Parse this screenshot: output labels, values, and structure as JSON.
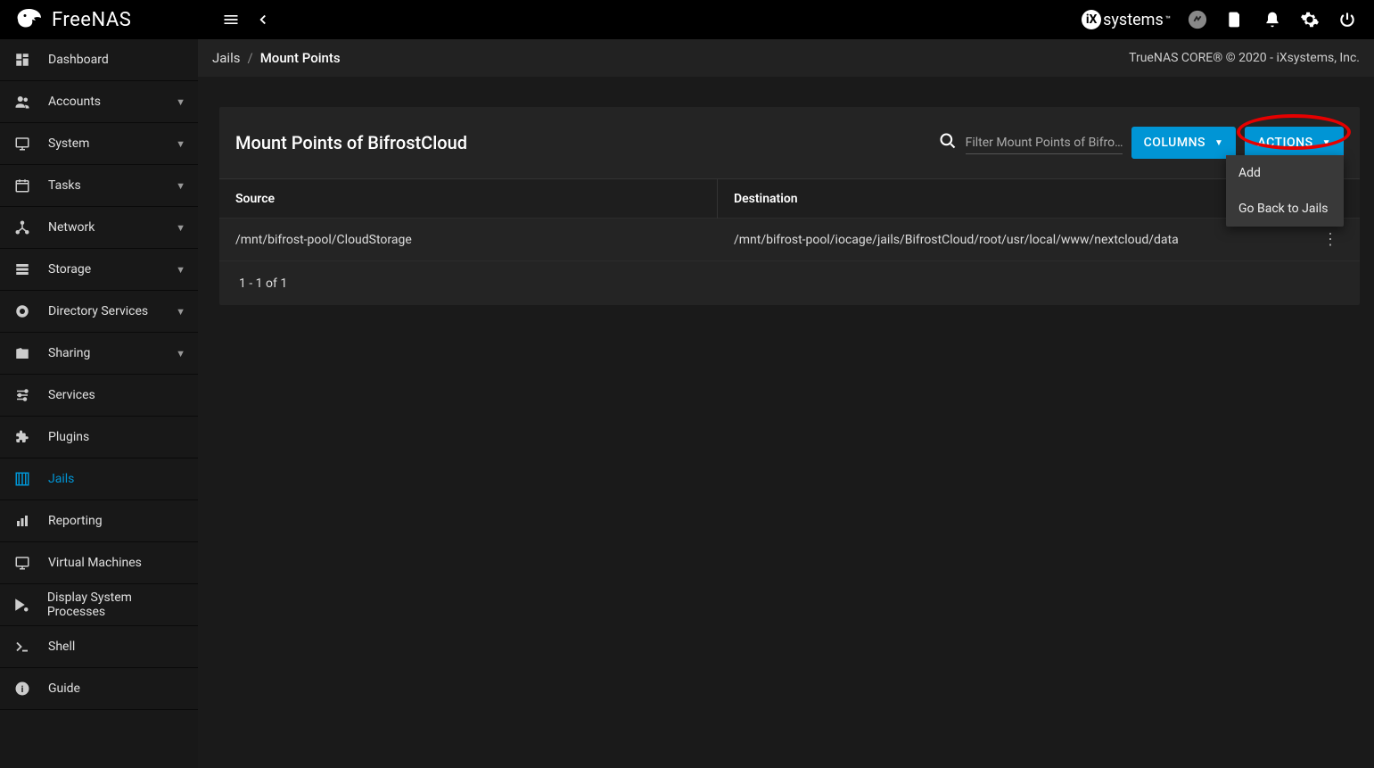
{
  "brand": {
    "name": "FreeNAS"
  },
  "ixsystems": "systems",
  "breadcrumb": {
    "root": "Jails",
    "current": "Mount Points"
  },
  "copyright": "TrueNAS CORE® © 2020 - iXsystems, Inc.",
  "sidebar": {
    "items": [
      {
        "label": "Dashboard",
        "icon": "dashboard",
        "expand": false
      },
      {
        "label": "Accounts",
        "icon": "accounts",
        "expand": true
      },
      {
        "label": "System",
        "icon": "system",
        "expand": true
      },
      {
        "label": "Tasks",
        "icon": "tasks",
        "expand": true
      },
      {
        "label": "Network",
        "icon": "network",
        "expand": true
      },
      {
        "label": "Storage",
        "icon": "storage",
        "expand": true
      },
      {
        "label": "Directory Services",
        "icon": "directory",
        "expand": true
      },
      {
        "label": "Sharing",
        "icon": "sharing",
        "expand": true
      },
      {
        "label": "Services",
        "icon": "services",
        "expand": false
      },
      {
        "label": "Plugins",
        "icon": "plugins",
        "expand": false
      },
      {
        "label": "Jails",
        "icon": "jails",
        "expand": false,
        "active": true
      },
      {
        "label": "Reporting",
        "icon": "reporting",
        "expand": false
      },
      {
        "label": "Virtual Machines",
        "icon": "vm",
        "expand": false
      },
      {
        "label": "Display System Processes",
        "icon": "processes",
        "expand": false
      },
      {
        "label": "Shell",
        "icon": "shell",
        "expand": false
      },
      {
        "label": "Guide",
        "icon": "guide",
        "expand": false
      }
    ]
  },
  "card": {
    "title": "Mount Points of BifrostCloud",
    "search_placeholder": "Filter Mount Points of Bifro…",
    "columns_btn": "COLUMNS",
    "actions_btn": "ACTIONS",
    "header_source": "Source",
    "header_dest": "Destination",
    "rows": [
      {
        "source": "/mnt/bifrost-pool/CloudStorage",
        "dest": "/mnt/bifrost-pool/iocage/jails/BifrostCloud/root/usr/local/www/nextcloud/data"
      }
    ],
    "footer": "1 - 1 of 1",
    "menu": {
      "add": "Add",
      "back": "Go Back to Jails"
    }
  }
}
